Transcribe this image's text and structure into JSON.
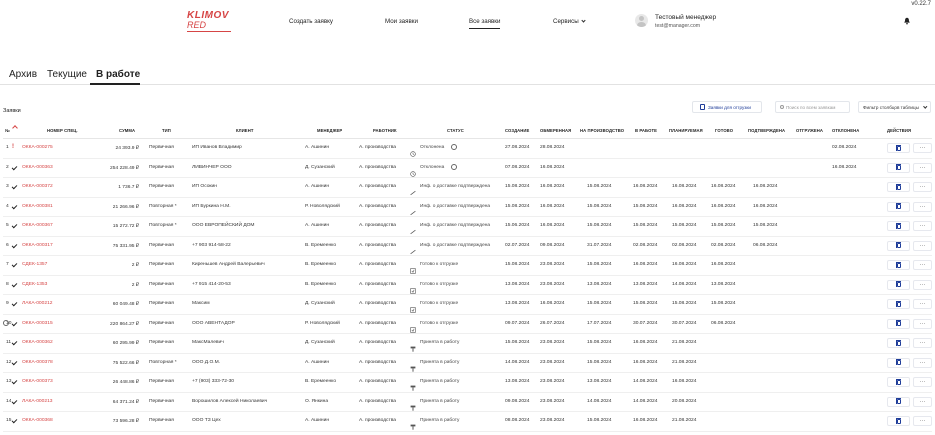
{
  "version": "v0.22.7",
  "logo": {
    "line1": "KLIMOV",
    "line2": "RED"
  },
  "nav": {
    "create": "Создать заявку",
    "mine": "Мои заявки",
    "all": "Все заявки",
    "services": "Сервисы"
  },
  "user": {
    "name": "Тестовый менеджер",
    "email": "test@manager.com"
  },
  "page_tabs": [
    "Архив",
    "Текущие",
    "В работе"
  ],
  "section_title": "Заявки",
  "toolbar": {
    "shipment_btn": "Заявки для отгрузки",
    "search_placeholder": "Поиск по всем заявкам",
    "filter": "Фильтр столбцов таблицы"
  },
  "columns": [
    "№",
    "НОМЕР СПЕЦ.",
    "СУММА",
    "ТИП",
    "КЛИЕНТ",
    "МЕНЕДЖЕР",
    "РАБОТНИК",
    "СТАТУС",
    "СОЗДАНИЕ",
    "ОБМЕРЕННАЯ",
    "НА ПРОИЗВОДСТВО",
    "В РАБОТЕ",
    "ПЛАНИРУЕМАЯ",
    "ГОТОВО",
    "ПОДТВЕРЖДЕНА",
    "ОТГРУЖЕНА",
    "ОТКЛОНЕНА",
    "ДЕЙСТВИЯ"
  ],
  "rows": [
    {
      "n": "1",
      "mark": "!",
      "spec": "ОККА-000275",
      "sum": "24 393.9 ₽",
      "type": "Первичная",
      "client": "ИП Иванов Владимир",
      "manager": "А. Ашинин",
      "worker": "А. производства",
      "status": "Отклонена",
      "status_icon": "history-icon",
      "extra": true,
      "d": [
        "27.08.2024",
        "28.08.2024",
        "",
        "",
        "",
        "",
        "",
        "",
        "02.08.2024"
      ]
    },
    {
      "n": "2",
      "mark": "check",
      "spec": "ОККА-000363",
      "sum": "254 228.49 ₽",
      "type": "Первичная",
      "client": "ЛИВИНЧЕР ООО",
      "manager": "Д. Сузанский",
      "worker": "А. производства",
      "status": "Отклонена",
      "status_icon": "history-icon",
      "extra": true,
      "d": [
        "07.08.2024",
        "16.08.2024",
        "",
        "",
        "",
        "",
        "",
        "",
        "16.08.2024"
      ]
    },
    {
      "n": "3",
      "mark": "check",
      "spec": "ОККА-000372",
      "sum": "1 736.7 ₽",
      "type": "Первичная",
      "client": "ИП Осокин",
      "manager": "А. Ашинин",
      "worker": "А. производства",
      "status": "Инф. о доставке подтверждена",
      "status_icon": "check-line-icon",
      "extra": false,
      "d": [
        "15.08.2024",
        "16.08.2024",
        "15.08.2024",
        "16.08.2024",
        "16.08.2024",
        "16.08.2024",
        "16.08.2024",
        "",
        ""
      ]
    },
    {
      "n": "4",
      "mark": "check",
      "spec": "ОККА-000381",
      "sum": "21 266.96 ₽",
      "type": "Повторная *",
      "client": "ИП Буркина Н.М.",
      "manager": "Р. Новолядский",
      "worker": "А. производства",
      "status": "Инф. о доставке подтверждена",
      "status_icon": "check-line-icon",
      "extra": false,
      "d": [
        "15.08.2024",
        "16.08.2024",
        "15.08.2024",
        "15.08.2024",
        "16.08.2024",
        "16.08.2024",
        "16.08.2024",
        "",
        ""
      ]
    },
    {
      "n": "5",
      "mark": "check",
      "spec": "ОККА-000367",
      "sum": "15 272.72 ₽",
      "type": "Повторная *",
      "client": "ООО ЕВРОПЕЙСКИЙ ДОМ",
      "manager": "А. Ашинин",
      "worker": "А. производства",
      "status": "Инф. о доставке подтверждена",
      "status_icon": "check-line-icon",
      "extra": false,
      "d": [
        "15.06.2024",
        "16.08.2024",
        "15.08.2024",
        "15.08.2024",
        "15.08.2024",
        "15.08.2024",
        "15.08.2024",
        "",
        ""
      ]
    },
    {
      "n": "6",
      "mark": "check",
      "spec": "ОККА-000317",
      "sum": "75 331.95 ₽",
      "type": "Первичная",
      "client": "+7 903 914-58-22",
      "manager": "В. Еремеенко",
      "worker": "А. производства",
      "status": "Инф. о доставке подтверждена",
      "status_icon": "check-line-icon",
      "extra": false,
      "d": [
        "02.07.2024",
        "09.08.2024",
        "31.07.2024",
        "02.08.2024",
        "02.08.2024",
        "02.08.2024",
        "06.08.2024",
        "",
        ""
      ]
    },
    {
      "n": "7",
      "mark": "check",
      "spec": "СДЕК-1357",
      "sum": "2 ₽",
      "type": "Первичная",
      "client": "Киреньшев Андрей Валерьевич",
      "manager": "В. Еремеенко",
      "worker": "А. производства",
      "status": "Готово к отгрузке",
      "status_icon": "box-icon",
      "extra": false,
      "d": [
        "15.08.2024",
        "23.08.2024",
        "15.08.2024",
        "16.08.2024",
        "16.08.2024",
        "16.08.2024",
        "",
        "",
        ""
      ]
    },
    {
      "n": "8",
      "mark": "check",
      "spec": "СДЕК-1353",
      "sum": "2 ₽",
      "type": "Первичная",
      "client": "+7 915 414-20-53",
      "manager": "В. Еремеенко",
      "worker": "А. производства",
      "status": "Готово к отгрузке",
      "status_icon": "box-icon",
      "extra": false,
      "d": [
        "13.08.2024",
        "23.08.2024",
        "13.08.2024",
        "13.08.2024",
        "14.08.2024",
        "13.08.2024",
        "",
        "",
        ""
      ]
    },
    {
      "n": "9",
      "mark": "check",
      "spec": "ЛАКА-000212",
      "sum": "60 049.48 ₽",
      "type": "Первичная",
      "client": "Максим",
      "manager": "Д. Сузанский",
      "worker": "А. производства",
      "status": "Готово к отгрузке",
      "status_icon": "box-icon",
      "extra": false,
      "d": [
        "13.08.2024",
        "16.08.2024",
        "15.08.2024",
        "15.08.2024",
        "15.08.2024",
        "15.08.2024",
        "",
        "",
        ""
      ]
    },
    {
      "n": "10",
      "mark": "check",
      "spec": "ОККА-000315",
      "sum": "220 864.27 ₽",
      "type": "Первичная",
      "client": "ООО АВЕНТАДОР",
      "manager": "Р. Новолядский",
      "worker": "А. производства",
      "status": "Готово к отгрузке",
      "status_icon": "box-icon",
      "extra": true,
      "d": [
        "09.07.2024",
        "26.07.2024",
        "17.07.2024",
        "30.07.2024",
        "30.07.2024",
        "06.08.2024",
        "",
        "",
        ""
      ]
    },
    {
      "n": "11",
      "mark": "check",
      "spec": "ОККА-000362",
      "sum": "60 295.99 ₽",
      "type": "Первичная",
      "client": "МаксМалевич",
      "manager": "Д. Сузанский",
      "worker": "А. производства",
      "status": "Принята в работу",
      "status_icon": "hammer-icon",
      "extra": false,
      "d": [
        "15.08.2024",
        "23.08.2024",
        "15.08.2024",
        "16.08.2024",
        "21.08.2024",
        "",
        "",
        "",
        ""
      ]
    },
    {
      "n": "12",
      "mark": "check",
      "spec": "ОККА-000378",
      "sum": "75 522.66 ₽",
      "type": "Повторная *",
      "client": "ООО Д.О.М.",
      "manager": "А. Ашинин",
      "worker": "А. производства",
      "status": "Принята в работу",
      "status_icon": "hammer-icon",
      "extra": false,
      "d": [
        "14.08.2024",
        "23.08.2024",
        "15.08.2024",
        "16.08.2024",
        "21.08.2024",
        "",
        "",
        "",
        ""
      ]
    },
    {
      "n": "13",
      "mark": "check",
      "spec": "ОККА-000373",
      "sum": "26 448.86 ₽",
      "type": "Первичная",
      "client": "+7 (903) 333-72-30",
      "manager": "В. Еремеенко",
      "worker": "А. производства",
      "status": "Принята в работу",
      "status_icon": "hammer-icon",
      "extra": false,
      "d": [
        "13.08.2024",
        "23.08.2024",
        "13.08.2024",
        "14.08.2024",
        "16.08.2024",
        "",
        "",
        "",
        ""
      ]
    },
    {
      "n": "14",
      "mark": "check",
      "spec": "ЛАКА-000213",
      "sum": "64 371.24 ₽",
      "type": "Первичная",
      "client": "Ворошилов Алексей Николаевич",
      "manager": "О. Янкина",
      "worker": "А. производства",
      "status": "Принята в работу",
      "status_icon": "hammer-icon",
      "extra": false,
      "d": [
        "09.08.2024",
        "23.08.2024",
        "14.08.2024",
        "14.08.2024",
        "20.08.2024",
        "",
        "",
        "",
        ""
      ]
    },
    {
      "n": "15",
      "mark": "check",
      "spec": "ОККА-000368",
      "sum": "73 596.28 ₽",
      "type": "Первичная",
      "client": "ООО ТЗ Цех",
      "manager": "А. Ашинин",
      "worker": "А. производства",
      "status": "Принята в работу",
      "status_icon": "hammer-icon",
      "extra": false,
      "d": [
        "08.08.2024",
        "23.08.2024",
        "15.08.2024",
        "16.08.2024",
        "21.08.2024",
        "",
        "",
        "",
        ""
      ]
    }
  ],
  "actions_more": "···",
  "colors": {
    "accent": "#d64545",
    "link_blue": "#1f3d99"
  }
}
